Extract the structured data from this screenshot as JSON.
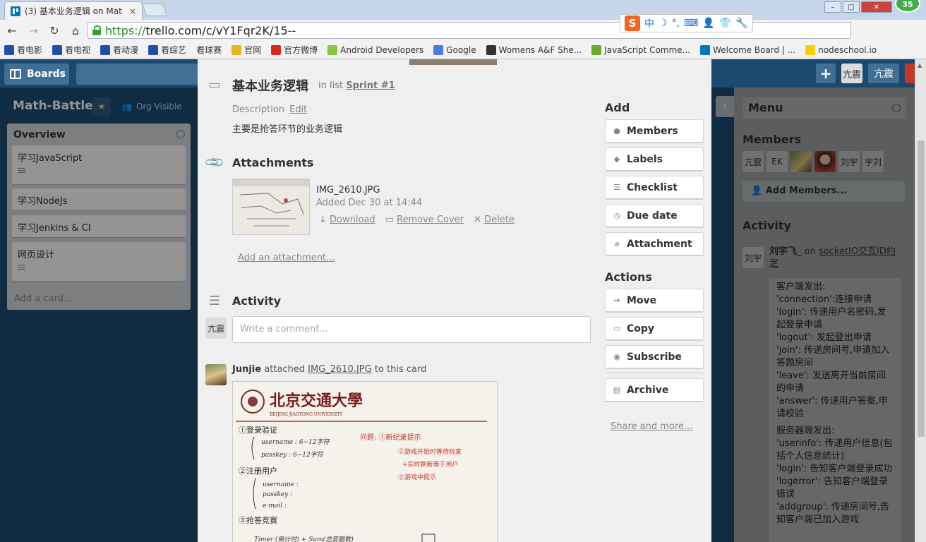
{
  "browser": {
    "tab_title": "(3) 基本业务逻辑 on Mat",
    "tab_close": "×",
    "url_https": "https://",
    "url_rest": "trello.com/c/vY1Fqr2K/15--",
    "notification_count": "35",
    "ime": {
      "logo": "S",
      "mode": "中"
    },
    "bookmarks": [
      {
        "label": "看电影",
        "icon": "baidu-icon",
        "color": "#1f4fa8"
      },
      {
        "label": "看电视",
        "icon": "baidu-icon",
        "color": "#1f4fa8"
      },
      {
        "label": "看动漫",
        "icon": "baidu-icon",
        "color": "#1f4fa8"
      },
      {
        "label": "看综艺",
        "icon": "baidu-icon",
        "color": "#1f4fa8"
      },
      {
        "label": "看球赛",
        "icon": "",
        "color": ""
      },
      {
        "label": "官网",
        "icon": "chrome-icon",
        "color": "#e8b321"
      },
      {
        "label": "官方微博",
        "icon": "weibo-icon",
        "color": "#d52b1e"
      },
      {
        "label": "Android Developers",
        "icon": "android-icon",
        "color": "#8ac53f"
      },
      {
        "label": "Google",
        "icon": "google-icon",
        "color": "#4a7be0"
      },
      {
        "label": "Womens A&F She...",
        "icon": "af-icon",
        "color": "#333333"
      },
      {
        "label": "JavaScript Comme...",
        "icon": "w3-icon",
        "color": "#6aaa2b"
      },
      {
        "label": "Welcome Board | ...",
        "icon": "trello-icon",
        "color": "#0079bf"
      },
      {
        "label": "nodeschool.io",
        "icon": "nodeschool-icon",
        "color": "#f5d000"
      }
    ]
  },
  "board": {
    "boards_label": "Boards",
    "title": "Math-Battle",
    "visibility": "Org Visible",
    "user_avatar": "亢震",
    "user_name": "亢震",
    "list": {
      "title": "Overview",
      "cards": [
        {
          "title": "学习JavaScript",
          "has_desc": true
        },
        {
          "title": "学习NodeJs",
          "has_desc": false
        },
        {
          "title": "学习Jenkins & CI",
          "has_desc": false
        },
        {
          "title": "网页设计",
          "has_desc": true
        }
      ],
      "add_card": "Add a card..."
    }
  },
  "card": {
    "title": "基本业务逻辑",
    "in_list": "in list",
    "list_name": "Sprint #1",
    "description_label": "Description",
    "edit_label": "Edit",
    "description": "主要是抢答环节的业务逻辑",
    "attachments_heading": "Attachments",
    "attachment": {
      "name": "IMG_2610.JPG",
      "added": "Added Dec 30 at 14:44",
      "download": "Download",
      "remove_cover": "Remove Cover",
      "delete": "Delete"
    },
    "add_attachment": "Add an attachment...",
    "activity_heading": "Activity",
    "comment_avatar": "亢震",
    "comment_placeholder": "Write a comment...",
    "activity_item": {
      "user": "Junjie",
      "action": "attached",
      "target": "IMG_2610.JPG",
      "suffix": "to this card"
    },
    "add_heading": "Add",
    "add_buttons": [
      {
        "label": "Members",
        "icon": "person-icon"
      },
      {
        "label": "Labels",
        "icon": "tag-icon"
      },
      {
        "label": "Checklist",
        "icon": "checklist-icon"
      },
      {
        "label": "Due date",
        "icon": "clock-icon"
      },
      {
        "label": "Attachment",
        "icon": "paperclip-icon"
      }
    ],
    "actions_heading": "Actions",
    "action_buttons": [
      {
        "label": "Move",
        "icon": "arrow-right-icon"
      },
      {
        "label": "Copy",
        "icon": "copy-icon"
      },
      {
        "label": "Subscribe",
        "icon": "eye-icon"
      }
    ],
    "archive_label": "Archive",
    "share_more": "Share and more..."
  },
  "sidebar": {
    "menu_title": "Menu",
    "members_heading": "Members",
    "members": [
      "亢震",
      "EK",
      "",
      "",
      "刘宇",
      "宇刘"
    ],
    "add_members": "Add Members...",
    "activity_heading": "Activity",
    "activity_avatar": "刘宇",
    "activity_user": "刘宇飞_",
    "activity_on": "on",
    "activity_target": "socketIO交互ID约定",
    "comment_lines_client": [
      "客户端发出:",
      "'connection':连接申请",
      "'login': 传递用户名密码,发起登录申请",
      "'logout': 发起登出申请",
      "'join': 传递房间号,申请加入答题房间",
      "'leave': 发送离开当前房间的申请",
      "'answer': 传递用户答案,申请校验"
    ],
    "comment_lines_server": [
      "服务器端发出:",
      "'userinfo': 传递用户信息(包括个人信息统计)",
      "'login': 告知客户端登录成功",
      "'logerror': 告知客户端登录错误",
      "'addgroup': 传递房间号,告知客户端已加入游戏"
    ]
  },
  "photo": {
    "header": "北京交通大學",
    "subheader": "BEIJING JIAOTONG UNIVERSITY",
    "line1": "①登录验证",
    "line2": "username : 6~12字符",
    "line3": "passkey : 6~12字符",
    "line4": "②注册用户",
    "line5": "username :",
    "line6": "passkey :",
    "line7": "e-mail :",
    "line8": "③抢答竞赛",
    "line9": "Timer (倒计时) + Sum(总答题数)",
    "red1": "问题: ①新纪录提示",
    "red2": "②游戏开始时等待玩家",
    "red3": "+实时刷新等于用户",
    "red4": "③游戏中提示"
  },
  "colors": {
    "board_bg": "#1d4d72",
    "trello_blue": "#0079bf",
    "modal_bg": "#efefef"
  }
}
